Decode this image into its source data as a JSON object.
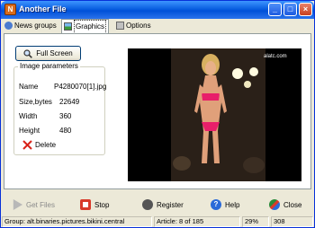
{
  "window": {
    "title": "Another File"
  },
  "tabs": [
    {
      "label": "News groups"
    },
    {
      "label": "Graphics"
    },
    {
      "label": "Options"
    }
  ],
  "graphics": {
    "full_screen_label": "Full Screen",
    "params_group_title": "Image parameters",
    "params": {
      "name_label": "Name",
      "name_value": "P4280070[1].jpg",
      "size_label": "Size,bytes",
      "size_value": "22649",
      "width_label": "Width",
      "width_value": "360",
      "height_label": "Height",
      "height_value": "480"
    },
    "delete_label": "Delete",
    "photo_watermark": "alatc.com"
  },
  "toolbar": {
    "get_files": "Get Files",
    "stop": "Stop",
    "register": "Register",
    "help": "Help",
    "close": "Close"
  },
  "statusbar": {
    "group": "Group: alt.binaries.pictures.bikini.central",
    "article": "Article: 8 of 185",
    "percent": "29%",
    "count": "308"
  },
  "colors": {
    "title_bar": "#0a5fe0",
    "stop_red": "#d83a2a",
    "help_blue": "#2a6ad8"
  }
}
